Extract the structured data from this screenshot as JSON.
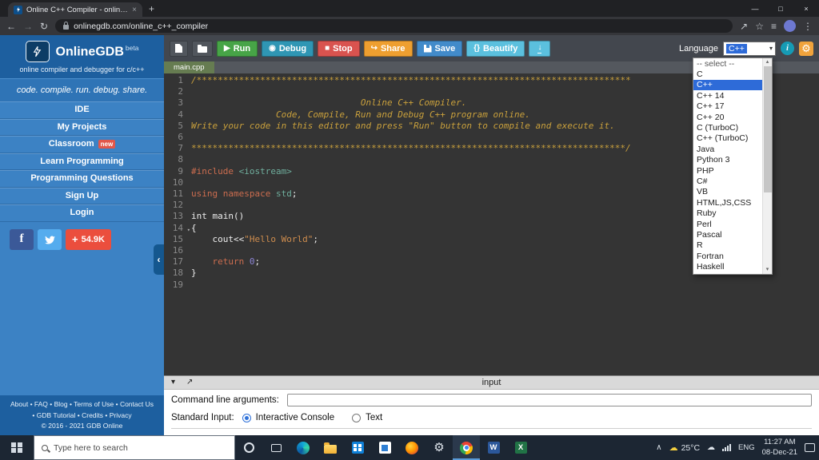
{
  "browser": {
    "tab_title": "Online C++ Compiler - online ed",
    "url": "onlinegdb.com/online_c++_compiler"
  },
  "icons": {
    "tab_close": "×",
    "new_tab": "+",
    "minimize": "—",
    "maximize": "□",
    "close": "×",
    "back": "←",
    "forward": "→",
    "refresh": "↻",
    "send": "↗",
    "star": "☆",
    "list": "≡",
    "menu_dots": "⋮",
    "run": "▶",
    "debug": "◉",
    "stop": "■",
    "share": "↪",
    "braces": "{}",
    "download": "↓",
    "info": "i",
    "gear": "⚙",
    "select_caret": "▾",
    "panel_collapse": "▾",
    "panel_expand": "↗",
    "sidebar_collapse": "‹",
    "fold": "▾",
    "scroll_up": "▴",
    "scroll_down": "▾",
    "tray_chevron": "∧",
    "weather_icon": "☁",
    "cloud": "☁"
  },
  "sidebar": {
    "logo_title": "OnlineGDB",
    "logo_beta": "beta",
    "logo_subtitle": "online compiler and debugger for c/c++",
    "tagline": "code. compile. run. debug. share.",
    "menu": [
      {
        "label": "IDE"
      },
      {
        "label": "My Projects"
      },
      {
        "label": "Classroom",
        "badge": "new"
      },
      {
        "label": "Learn Programming"
      },
      {
        "label": "Programming Questions"
      },
      {
        "label": "Sign Up"
      },
      {
        "label": "Login"
      }
    ],
    "social": {
      "facebook_letter": "f",
      "share_plus": "+",
      "share_count": "54.9K"
    },
    "footer_line1": "About • FAQ • Blog • Terms of Use • Contact Us",
    "footer_line2": "• GDB Tutorial • Credits • Privacy",
    "footer_line3": "© 2016 - 2021 GDB Online"
  },
  "toolbar": {
    "run": "Run",
    "debug": "Debug",
    "stop": "Stop",
    "share": "Share",
    "save": "Save",
    "beautify": "Beautify",
    "language_label": "Language",
    "language_value": "C++"
  },
  "editor": {
    "file_tab": "main.cpp",
    "lines": [
      {
        "n": "1",
        "seg": [
          [
            "/**********************************************************************************",
            "comment"
          ]
        ]
      },
      {
        "n": "2",
        "seg": []
      },
      {
        "n": "3",
        "seg": [
          [
            "                                Online C++ Compiler.",
            "comment"
          ]
        ]
      },
      {
        "n": "4",
        "seg": [
          [
            "                Code, Compile, Run and Debug C++ program online.",
            "comment"
          ]
        ]
      },
      {
        "n": "5",
        "seg": [
          [
            "Write your code in this editor and press \"Run\" button to compile and execute it.",
            "comment"
          ]
        ]
      },
      {
        "n": "6",
        "seg": []
      },
      {
        "n": "7",
        "seg": [
          [
            "**********************************************************************************/",
            "comment"
          ]
        ]
      },
      {
        "n": "8",
        "seg": []
      },
      {
        "n": "9",
        "seg": [
          [
            "#include",
            "directive"
          ],
          [
            " ",
            "plain"
          ],
          [
            "<iostream>",
            "include"
          ]
        ]
      },
      {
        "n": "10",
        "seg": []
      },
      {
        "n": "11",
        "seg": [
          [
            "using",
            "directive"
          ],
          [
            " ",
            "plain"
          ],
          [
            "namespace",
            "directive"
          ],
          [
            " ",
            "plain"
          ],
          [
            "std",
            "include"
          ],
          [
            ";",
            "plain"
          ]
        ]
      },
      {
        "n": "12",
        "seg": []
      },
      {
        "n": "13",
        "seg": [
          [
            "int main()",
            "plain"
          ]
        ]
      },
      {
        "n": "14",
        "fold": true,
        "seg": [
          [
            "{",
            "plain"
          ]
        ]
      },
      {
        "n": "15",
        "seg": [
          [
            "    cout<<",
            "plain"
          ],
          [
            "\"Hello World\"",
            "string"
          ],
          [
            ";",
            "plain"
          ]
        ]
      },
      {
        "n": "16",
        "seg": []
      },
      {
        "n": "17",
        "seg": [
          [
            "    ",
            "plain"
          ],
          [
            "return",
            "directive"
          ],
          [
            " ",
            "plain"
          ],
          [
            "0",
            "number"
          ],
          [
            ";",
            "plain"
          ]
        ]
      },
      {
        "n": "18",
        "seg": [
          [
            "}",
            "plain"
          ]
        ]
      },
      {
        "n": "19",
        "seg": []
      }
    ]
  },
  "language_dropdown": {
    "selected": "C++",
    "options": [
      "-- select --",
      "C",
      "C++",
      "C++ 14",
      "C++ 17",
      "C++ 20",
      "C (TurboC)",
      "C++ (TurboC)",
      "Java",
      "Python 3",
      "PHP",
      "C#",
      "VB",
      "HTML,JS,CSS",
      "Ruby",
      "Perl",
      "Pascal",
      "R",
      "Fortran",
      "Haskell"
    ]
  },
  "input_panel": {
    "title": "input",
    "cmd_args_label": "Command line arguments:",
    "stdin_label": "Standard Input:",
    "radio_interactive": "Interactive Console",
    "radio_text": "Text"
  },
  "taskbar": {
    "search_placeholder": "Type here to search",
    "temperature": "25°C",
    "language": "ENG",
    "time": "11:27 AM",
    "date": "08-Dec-21",
    "word_letter": "W",
    "excel_letter": "X"
  }
}
